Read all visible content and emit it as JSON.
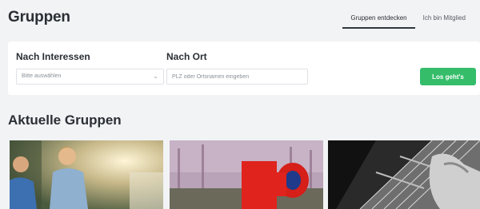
{
  "header": {
    "title": "Gruppen",
    "tabs": [
      {
        "label": "Gruppen entdecken",
        "active": true
      },
      {
        "label": "Ich bin Mitglied",
        "active": false
      }
    ]
  },
  "filters": {
    "interests": {
      "label": "Nach Interessen",
      "placeholder": "Bitte auswählen",
      "icon": "chevron-down-icon"
    },
    "location": {
      "label": "Nach Ort",
      "placeholder": "PLZ oder Ortsnamen eingeben"
    },
    "submit_label": "Los geht's",
    "accent_color": "#35bd6a"
  },
  "groups_section": {
    "title": "Aktuelle Gruppen",
    "cards": [
      {
        "image": "children-outdoors-photo"
      },
      {
        "image": "playground-red-sculpture-photo"
      },
      {
        "image": "guitar-closeup-photo"
      }
    ]
  }
}
